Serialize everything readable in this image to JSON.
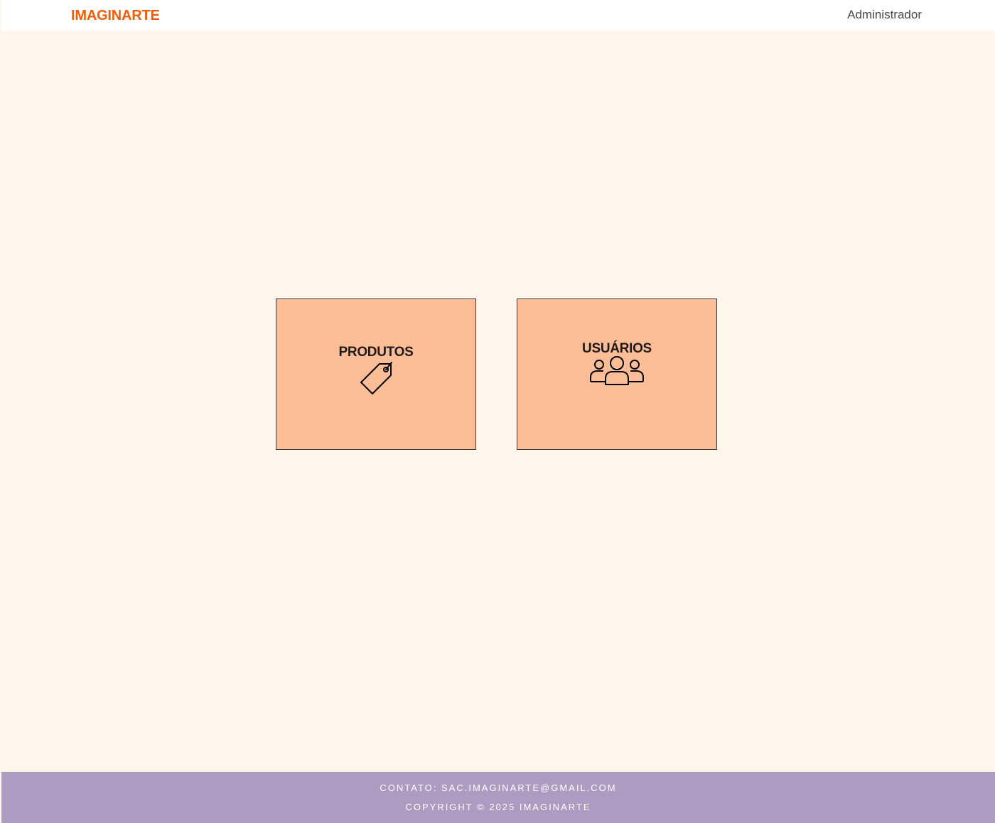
{
  "header": {
    "brand": "IMAGINARTE",
    "user": "Administrador"
  },
  "cards": [
    {
      "label": "PRODUTOS",
      "icon": "price-tag-icon"
    },
    {
      "label": "USUÁRIOS",
      "icon": "users-group-icon"
    }
  ],
  "footer": {
    "contact": "CONTATO: SAC.IMAGINARTE@GMAIL.COM",
    "copyright": "COPYRIGHT © 2025 IMAGINARTE"
  },
  "colors": {
    "brand": "#f25c05",
    "background": "#fff5eb",
    "card": "#fdbd96",
    "footer": "#af9bc2"
  }
}
